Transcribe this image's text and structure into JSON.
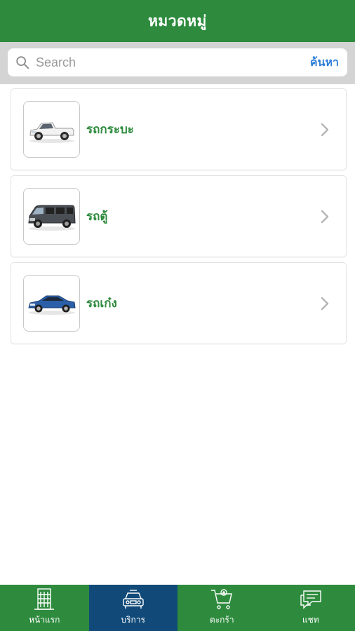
{
  "header": {
    "title": "หมวดหมู่"
  },
  "search": {
    "placeholder": "Search",
    "value": "",
    "button_label": "ค้นหา"
  },
  "categories": [
    {
      "label": "รถกระบะ",
      "icon": "pickup-truck-image"
    },
    {
      "label": "รถตู้",
      "icon": "van-image"
    },
    {
      "label": "รถเก๋ง",
      "icon": "sedan-image"
    }
  ],
  "tabs": [
    {
      "label": "หน้าแรก",
      "icon": "building-icon",
      "active": false
    },
    {
      "label": "บริการ",
      "icon": "car-service-icon",
      "active": true
    },
    {
      "label": "ตะกร้า",
      "icon": "cart-icon",
      "active": false
    },
    {
      "label": "แชท",
      "icon": "chat-icon",
      "active": false
    }
  ],
  "colors": {
    "primary": "#2e8b3e",
    "active_tab": "#114a78",
    "link": "#2f7fd8",
    "search_bg": "#d4d4d4"
  }
}
